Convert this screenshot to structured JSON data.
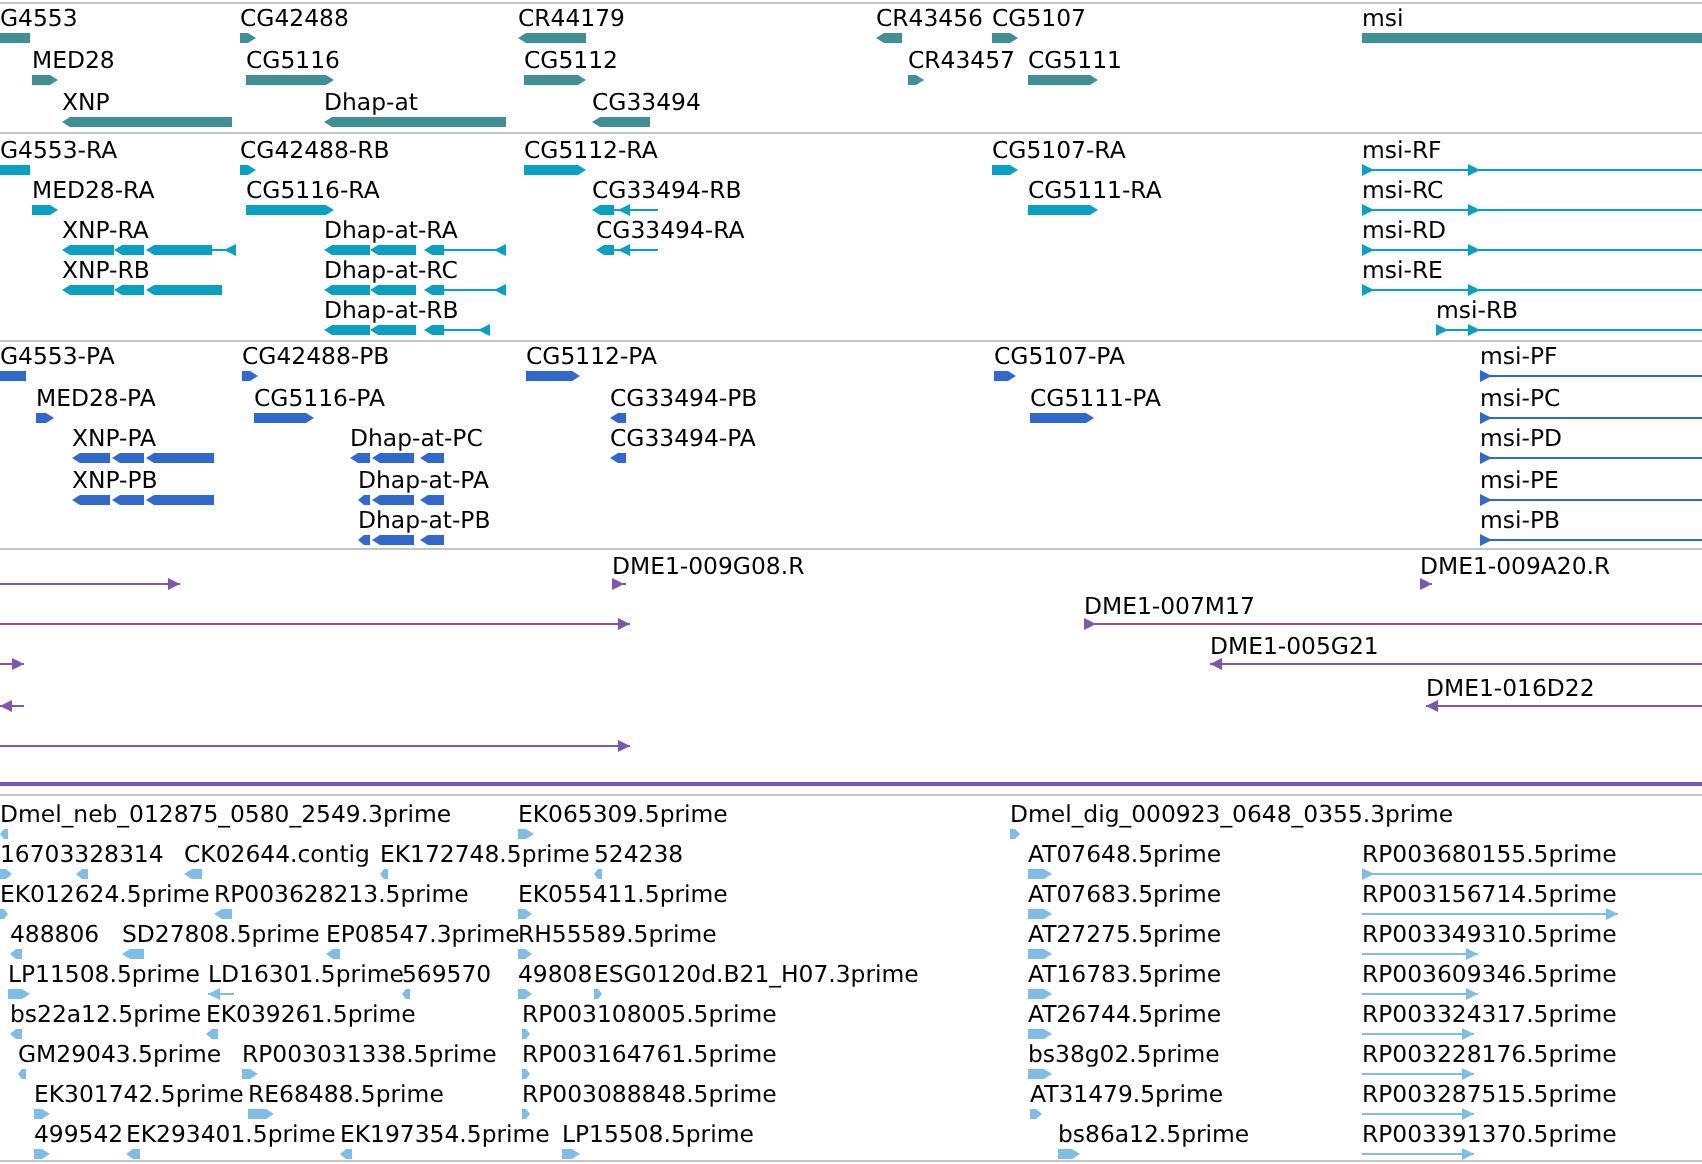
{
  "tracks": [
    {
      "kind": "gene",
      "features": [
        {
          "label": "G4553"
        },
        {
          "label": "MED28",
          "reverse": false
        },
        {
          "label": "XNP",
          "reverse": true
        },
        {
          "label": "CG42488",
          "reverse": false
        },
        {
          "label": "CG5116",
          "reverse": false
        },
        {
          "label": "Dhap-at",
          "reverse": true
        },
        {
          "label": "CR44179",
          "reverse": true
        },
        {
          "label": "CG5112",
          "reverse": false
        },
        {
          "label": "CG33494",
          "reverse": true
        },
        {
          "label": "CR43456",
          "reverse": true
        },
        {
          "label": "CG5107",
          "reverse": false
        },
        {
          "label": "CR43457",
          "reverse": false
        },
        {
          "label": "CG5111",
          "reverse": false
        },
        {
          "label": "msi"
        }
      ]
    },
    {
      "kind": "transcript",
      "features": [
        {
          "label": "G4553-RA"
        },
        {
          "label": "MED28-RA",
          "reverse": false
        },
        {
          "label": "XNP-RA",
          "reverse": true
        },
        {
          "label": "XNP-RB",
          "reverse": true
        },
        {
          "label": "CG42488-RB",
          "reverse": false
        },
        {
          "label": "CG5116-RA",
          "reverse": false
        },
        {
          "label": "Dhap-at-RA",
          "reverse": true
        },
        {
          "label": "Dhap-at-RC",
          "reverse": true
        },
        {
          "label": "Dhap-at-RB",
          "reverse": true
        },
        {
          "label": "CG5112-RA",
          "reverse": false
        },
        {
          "label": "CG33494-RB",
          "reverse": true
        },
        {
          "label": "CG33494-RA",
          "reverse": true
        },
        {
          "label": "CG5107-RA",
          "reverse": false
        },
        {
          "label": "CG5111-RA",
          "reverse": false
        },
        {
          "label": "msi-RF",
          "reverse": false
        },
        {
          "label": "msi-RC",
          "reverse": false
        },
        {
          "label": "msi-RD",
          "reverse": false
        },
        {
          "label": "msi-RE",
          "reverse": false
        },
        {
          "label": "msi-RB",
          "reverse": false
        }
      ]
    },
    {
      "kind": "protein",
      "features": [
        {
          "label": "G4553-PA"
        },
        {
          "label": "MED28-PA",
          "reverse": false
        },
        {
          "label": "XNP-PA",
          "reverse": true
        },
        {
          "label": "XNP-PB",
          "reverse": true
        },
        {
          "label": "CG42488-PB",
          "reverse": false
        },
        {
          "label": "CG5116-PA",
          "reverse": false
        },
        {
          "label": "Dhap-at-PC",
          "reverse": true
        },
        {
          "label": "Dhap-at-PA",
          "reverse": true
        },
        {
          "label": "Dhap-at-PB",
          "reverse": true
        },
        {
          "label": "CG5112-PA",
          "reverse": false
        },
        {
          "label": "CG33494-PB",
          "reverse": true
        },
        {
          "label": "CG33494-PA",
          "reverse": true
        },
        {
          "label": "CG5107-PA",
          "reverse": false
        },
        {
          "label": "CG5111-PA",
          "reverse": false
        },
        {
          "label": "msi-PF",
          "reverse": false
        },
        {
          "label": "msi-PC",
          "reverse": false
        },
        {
          "label": "msi-PD",
          "reverse": false
        },
        {
          "label": "msi-PE",
          "reverse": false
        },
        {
          "label": "msi-PB",
          "reverse": false
        }
      ]
    },
    {
      "kind": "clone",
      "features": [
        {
          "reverse": false
        },
        {
          "label": "DME1-009G08.R",
          "reverse": false
        },
        {
          "label": "DME1-009A20.R",
          "reverse": false
        },
        {
          "reverse": false
        },
        {
          "label": "DME1-007M17",
          "reverse": false
        },
        {
          "reverse": false
        },
        {
          "label": "DME1-005G21",
          "reverse": true
        },
        {
          "reverse": true
        },
        {
          "label": "DME1-016D22",
          "reverse": true
        },
        {
          "reverse": false
        }
      ]
    },
    {
      "kind": "est",
      "features": [
        {
          "label": "Dmel_neb_012875_0580_2549.3prime",
          "reverse": true
        },
        {
          "label": "EK065309.5prime",
          "reverse": false
        },
        {
          "label": "Dmel_dig_000923_0648_0355.3prime",
          "reverse": false
        },
        {
          "label": "16703328314",
          "reverse": false
        },
        {
          "reverse": true
        },
        {
          "label": "CK02644.contig",
          "reverse": true
        },
        {
          "label": "EK172748.5prime",
          "reverse": true
        },
        {
          "label": "524238",
          "reverse": true
        },
        {
          "label": "AT07648.5prime",
          "reverse": false
        },
        {
          "label": "RP003680155.5prime",
          "reverse": false
        },
        {
          "label": "EK012624.5prime",
          "reverse": false
        },
        {
          "label": "RP003628213.5prime",
          "reverse": true
        },
        {
          "label": "EK055411.5prime",
          "reverse": false
        },
        {
          "label": "AT07683.5prime",
          "reverse": false
        },
        {
          "label": "RP003156714.5prime",
          "reverse": false
        },
        {
          "label": "488806",
          "reverse": true
        },
        {
          "label": "SD27808.5prime",
          "reverse": true
        },
        {
          "label": "EP08547.3prime",
          "reverse": true
        },
        {
          "label": "RH55589.5prime",
          "reverse": false
        },
        {
          "label": "AT27275.5prime",
          "reverse": false
        },
        {
          "label": "RP003349310.5prime",
          "reverse": false
        },
        {
          "label": "LP11508.5prime",
          "reverse": false
        },
        {
          "label": "LD16301.5prime",
          "reverse": true
        },
        {
          "label": "569570",
          "reverse": true
        },
        {
          "label": "49808",
          "reverse": false
        },
        {
          "label": "ESG0120d.B21_H07.3prime",
          "reverse": false
        },
        {
          "label": "AT16783.5prime",
          "reverse": false
        },
        {
          "label": "RP003609346.5prime",
          "reverse": false
        },
        {
          "label": "bs22a12.5prime",
          "reverse": true
        },
        {
          "label": "EK039261.5prime",
          "reverse": true
        },
        {
          "label": "RP003108005.5prime",
          "reverse": false
        },
        {
          "label": "AT26744.5prime",
          "reverse": false
        },
        {
          "label": "RP003324317.5prime",
          "reverse": false
        },
        {
          "label": "GM29043.5prime",
          "reverse": true
        },
        {
          "label": "RP003031338.5prime",
          "reverse": false
        },
        {
          "label": "RP003164761.5prime",
          "reverse": false
        },
        {
          "label": "bs38g02.5prime",
          "reverse": false
        },
        {
          "label": "RP003228176.5prime",
          "reverse": false
        },
        {
          "label": "EK301742.5prime",
          "reverse": false
        },
        {
          "label": "RE68488.5prime",
          "reverse": false
        },
        {
          "label": "RP003088848.5prime",
          "reverse": false
        },
        {
          "label": "AT31479.5prime",
          "reverse": false
        },
        {
          "label": "RP003287515.5prime",
          "reverse": false
        },
        {
          "label": "499542",
          "reverse": false
        },
        {
          "label": "EK293401.5prime",
          "reverse": true
        },
        {
          "label": "EK197354.5prime",
          "reverse": true
        },
        {
          "label": "LP15508.5prime",
          "reverse": false
        },
        {
          "label": "bs86a12.5prime",
          "reverse": false
        },
        {
          "label": "RP003391370.5prime",
          "reverse": false
        }
      ]
    }
  ]
}
